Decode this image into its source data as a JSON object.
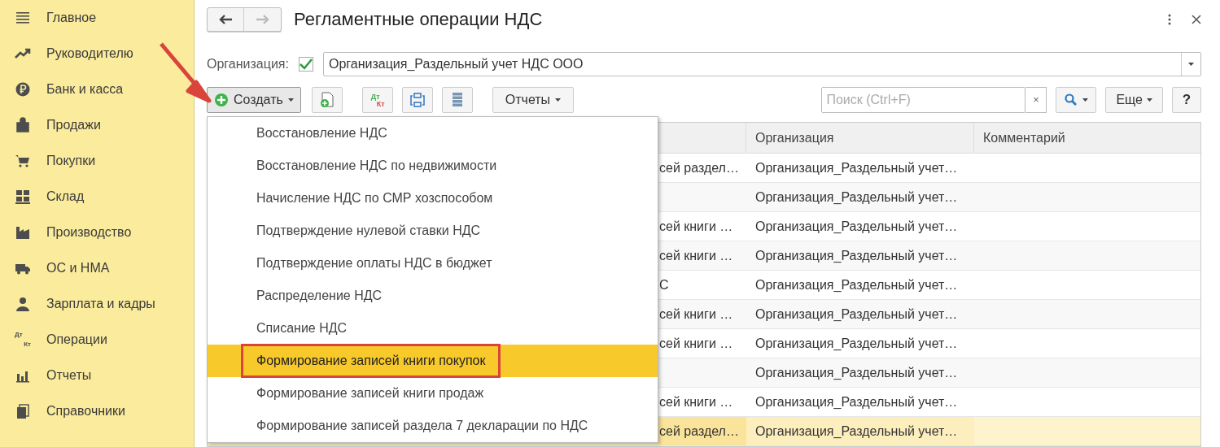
{
  "sidebar": {
    "items": [
      {
        "label": "Главное"
      },
      {
        "label": "Руководителю"
      },
      {
        "label": "Банк и касса"
      },
      {
        "label": "Продажи"
      },
      {
        "label": "Покупки"
      },
      {
        "label": "Склад"
      },
      {
        "label": "Производство"
      },
      {
        "label": "ОС и НМА"
      },
      {
        "label": "Зарплата и кадры"
      },
      {
        "label": "Операции",
        "icon_text": [
          "Дт",
          "Кт"
        ]
      },
      {
        "label": "Отчеты"
      },
      {
        "label": "Справочники"
      }
    ]
  },
  "header": {
    "title": "Регламентные операции НДС",
    "back_enabled": true,
    "forward_enabled": false
  },
  "organization": {
    "label": "Организация:",
    "checked": true,
    "value": "Организация_Раздельный учет НДС ООО"
  },
  "toolbar": {
    "create": "Создать",
    "dt_kt": [
      "Дт",
      "Кт"
    ],
    "reports": "Отчеты",
    "search": {
      "placeholder": "Поиск (Ctrl+F)"
    },
    "clear": "×",
    "more": "Еще",
    "help": "?"
  },
  "table": {
    "columns": [
      "Организация",
      "Комментарий"
    ],
    "rows": [
      {
        "column_1": "сей раздел…",
        "organization": "Организация_Раздельный учет…",
        "selected": false
      },
      {
        "column_1": "",
        "organization": "Организация_Раздельный учет…",
        "selected": false
      },
      {
        "column_1": "сей книги …",
        "organization": "Организация_Раздельный учет…",
        "selected": false
      },
      {
        "column_1": "сей книги …",
        "organization": "Организация_Раздельный учет…",
        "selected": false
      },
      {
        "column_1": "С",
        "organization": "Организация_Раздельный учет…",
        "selected": false
      },
      {
        "column_1": "сей книги …",
        "organization": "Организация_Раздельный учет…",
        "selected": false
      },
      {
        "column_1": "сей книги …",
        "organization": "Организация_Раздельный учет…",
        "selected": false
      },
      {
        "column_1": "",
        "organization": "Организация_Раздельный учет…",
        "selected": false
      },
      {
        "column_1": "сей книги …",
        "organization": "Организация_Раздельный учет…",
        "selected": false
      },
      {
        "column_1": "сей раздел…",
        "organization": "Организация_Раздельный учет…",
        "selected": true
      }
    ]
  },
  "create_menu": {
    "items": [
      {
        "label": "Восстановление НДС",
        "selected": false,
        "outlined": false
      },
      {
        "label": "Восстановление НДС по недвижимости",
        "selected": false,
        "outlined": false
      },
      {
        "label": "Начисление НДС по СМР хозспособом",
        "selected": false,
        "outlined": false
      },
      {
        "label": "Подтверждение нулевой ставки НДС",
        "selected": false,
        "outlined": false
      },
      {
        "label": "Подтверждение оплаты НДС в бюджет",
        "selected": false,
        "outlined": false
      },
      {
        "label": "Распределение НДС",
        "selected": false,
        "outlined": false
      },
      {
        "label": "Списание НДС",
        "selected": false,
        "outlined": false
      },
      {
        "label": "Формирование записей книги покупок",
        "selected": true,
        "outlined": true
      },
      {
        "label": "Формирование записей книги продаж",
        "selected": false,
        "outlined": false
      },
      {
        "label": "Формирование записей раздела 7 декларации по НДС",
        "selected": false,
        "outlined": false
      }
    ]
  }
}
